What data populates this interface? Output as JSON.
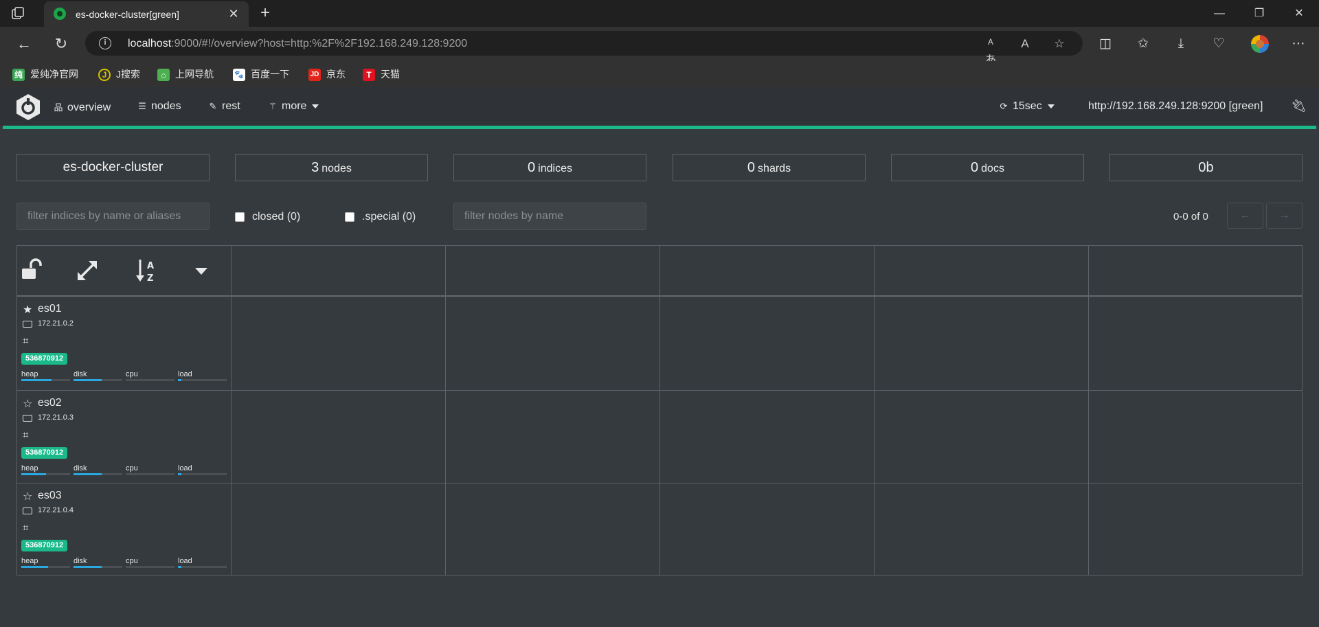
{
  "browser": {
    "tab_title": "es-docker-cluster[green]",
    "url_host": "localhost",
    "url_rest": ":9000/#!/overview?host=http:%2F%2F192.168.249.128:9200",
    "bookmarks": [
      {
        "label": "爱纯净官网",
        "icon_text": "纯",
        "color": "#3aa757"
      },
      {
        "label": "J搜索",
        "icon_text": "J",
        "color": "#d6c100"
      },
      {
        "label": "上网导航",
        "icon_text": "⌂",
        "color": "#4caf50"
      },
      {
        "label": "百度一下",
        "icon_text": "🐾",
        "color": "#2f6de0"
      },
      {
        "label": "京东",
        "icon_text": "JD",
        "color": "#e1251b"
      },
      {
        "label": "天猫",
        "icon_text": "T",
        "color": "#e01222"
      }
    ]
  },
  "app": {
    "nav": {
      "overview": "overview",
      "nodes": "nodes",
      "rest": "rest",
      "more": "more",
      "refresh": "15sec",
      "host": "http://192.168.249.128:9200 [green]"
    },
    "status_color": "#1bb98a",
    "stats": {
      "cluster_name": "es-docker-cluster",
      "nodes_count": "3",
      "nodes_label": "nodes",
      "indices_count": "0",
      "indices_label": "indices",
      "shards_count": "0",
      "shards_label": "shards",
      "docs_count": "0",
      "docs_label": "docs",
      "size": "0b"
    },
    "filters": {
      "indices_placeholder": "filter indices by name or aliases",
      "closed_label": "closed (0)",
      "special_label": ".special (0)",
      "nodes_placeholder": "filter nodes by name"
    },
    "pager": {
      "text": "0-0 of 0",
      "prev": "←",
      "next": "→"
    },
    "metric_labels": {
      "heap": "heap",
      "disk": "disk",
      "cpu": "cpu",
      "load": "load"
    },
    "nodes": [
      {
        "name": "es01",
        "ip": "172.21.0.2",
        "id": "536870912",
        "master": true,
        "heap": 0.62,
        "disk": 0.58,
        "cpu": 0.0,
        "load": 0.07
      },
      {
        "name": "es02",
        "ip": "172.21.0.3",
        "id": "536870912",
        "master": false,
        "heap": 0.5,
        "disk": 0.58,
        "cpu": 0.0,
        "load": 0.07
      },
      {
        "name": "es03",
        "ip": "172.21.0.4",
        "id": "536870912",
        "master": false,
        "heap": 0.55,
        "disk": 0.58,
        "cpu": 0.0,
        "load": 0.07
      }
    ]
  }
}
